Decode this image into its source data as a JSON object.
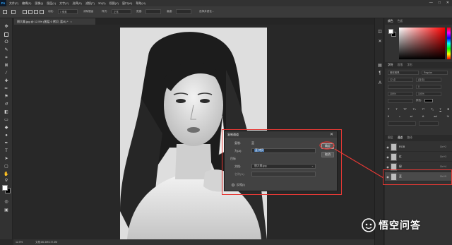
{
  "app": {
    "logo": "Ps"
  },
  "menu": [
    "文件(F)",
    "编辑(E)",
    "图像(I)",
    "图层(L)",
    "文字(Y)",
    "选择(S)",
    "滤镜(T)",
    "3D(D)",
    "视图(V)",
    "窗口(W)",
    "帮助(H)"
  ],
  "window_controls": [
    "—",
    "□",
    "✕"
  ],
  "options_bar": {
    "feather_label": "羽化:",
    "feather_value": "0 像素",
    "antialias_label": "消除锯齿",
    "style_label": "样式:",
    "style_value": "正常",
    "width_label": "宽度:",
    "height_label": "高度:",
    "select_mask_label": "选择并遮住..."
  },
  "document_tab": {
    "title": "朋大美.jpg @ 12.5% (图层 0 拷贝, 蓝/8) *",
    "close": "×"
  },
  "status_bar": {
    "zoom": "12.5%",
    "doc_info": "文档:86.3M/172.3M"
  },
  "panels": {
    "color_tabs": [
      "颜色",
      "色板"
    ],
    "char_tabs": [
      "字符",
      "段落",
      "字形"
    ],
    "layers_tabs": [
      "图层",
      "通道",
      "路径"
    ],
    "char_font": "微软雅黑",
    "char_style": "Regular",
    "char_size": "12 点",
    "char_leading": "(自动)",
    "char_tracking": "0",
    "char_scale_v": "100%",
    "char_scale_h": "100%",
    "char_color_label": "颜色:"
  },
  "channels": [
    {
      "name": "RGB",
      "shortcut": "Ctrl+2",
      "selected": false
    },
    {
      "name": "红",
      "shortcut": "Ctrl+3",
      "selected": false
    },
    {
      "name": "绿",
      "shortcut": "Ctrl+4",
      "selected": false
    },
    {
      "name": "蓝",
      "shortcut": "Ctrl+5",
      "selected": true
    }
  ],
  "dialog": {
    "title": "复制通道",
    "close": "✕",
    "copy_label": "复制:",
    "copy_value": "蓝",
    "as_label": "为(A):",
    "as_value": "蓝 拷贝",
    "target_label": "目标",
    "doc_label": "文档:",
    "doc_value": "朋大美.jpg",
    "name_label": "名称(N):",
    "invert_label": "反相(I)",
    "ok_label": "确定",
    "cancel_label": "取消"
  },
  "watermark": {
    "text": "悟空问答"
  },
  "colors": {
    "highlight": "#e53935",
    "selection": "#3c6ea8",
    "ui_dark": "#282828",
    "ui_panel": "#323232"
  }
}
